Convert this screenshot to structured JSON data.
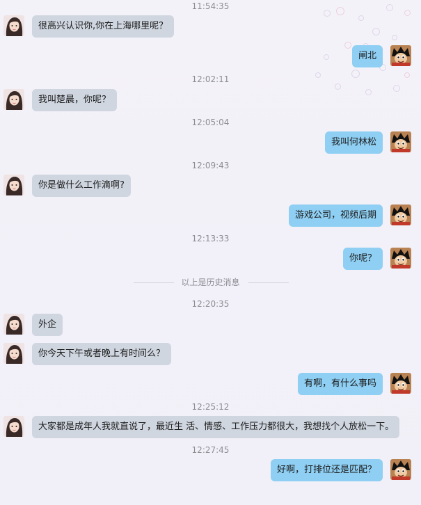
{
  "messages": {
    "ts0": "11:54:35",
    "m1": "很高兴认识你,你在上海哪里呢？",
    "m2": "闸北",
    "ts1": "12:02:11",
    "m3": "我叫楚晨，你呢？",
    "ts2": "12:05:04",
    "m4": "我叫何林松",
    "ts3": "12:09:43",
    "m5": "你是做什么工作滴啊?",
    "m6": "游戏公司，视频后期",
    "ts4": "12:13:33",
    "m7": "你呢？",
    "divider": "以上是历史消息",
    "ts5": "12:20:35",
    "m8": "外企",
    "m9": "你今天下午或者晚上有时间么？",
    "m10": "有啊，有什么事吗",
    "ts6": "12:25:12",
    "m11": "大家都是成年人我就直说了，最近生 活、情感、工作压力都很大，我想找个人放松一下。",
    "ts7": "12:27:45",
    "m12": "好啊，打排位还是匹配？"
  },
  "avatars": {
    "contact": "girl-avatar",
    "self": "anime-boy-avatar"
  },
  "colors": {
    "incoming_bubble": "#cfd6e0",
    "outgoing_bubble": "#8ecff3",
    "timestamp": "#8d8d94",
    "background": "#f3f1f8"
  }
}
